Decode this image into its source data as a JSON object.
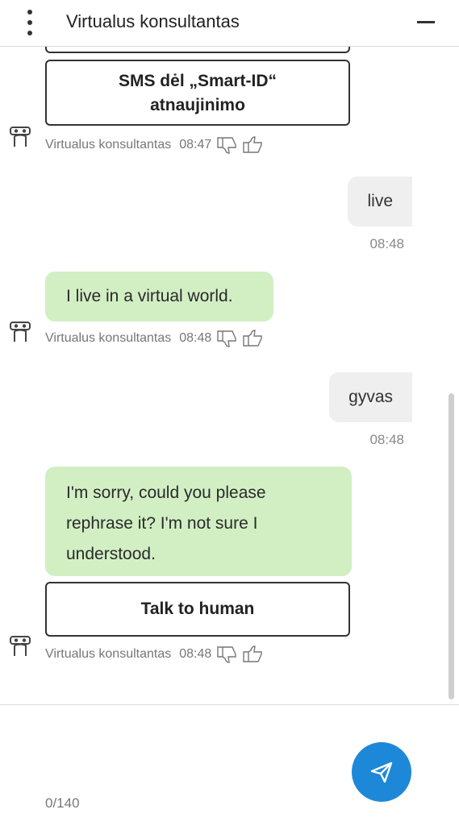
{
  "header": {
    "title": "Virtualus konsultantas"
  },
  "messages": {
    "option_top_label": "SMS dėl „Smart-ID“ atnaujinimo",
    "bot_name": "Virtualus konsultantas",
    "meta1_time": "08:47",
    "user1_text": "live",
    "user1_time": "08:48",
    "bot2_text": "I live in a virtual world.",
    "meta2_time": "08:48",
    "user2_text": "gyvas",
    "user2_time": "08:48",
    "bot3_text": "I'm sorry, could you please rephrase it? I'm not sure I understood.",
    "option_talk_label": "Talk to human",
    "meta3_time": "08:48"
  },
  "composer": {
    "counter": "0/140"
  },
  "colors": {
    "bot_bubble": "#d2efc4",
    "user_bubble": "#efefef",
    "send_button": "#1e88d8"
  },
  "icons": [
    "kebab-menu-icon",
    "minimize-icon",
    "robot-avatar-icon",
    "thumbs-down-icon",
    "thumbs-up-icon",
    "send-icon"
  ]
}
